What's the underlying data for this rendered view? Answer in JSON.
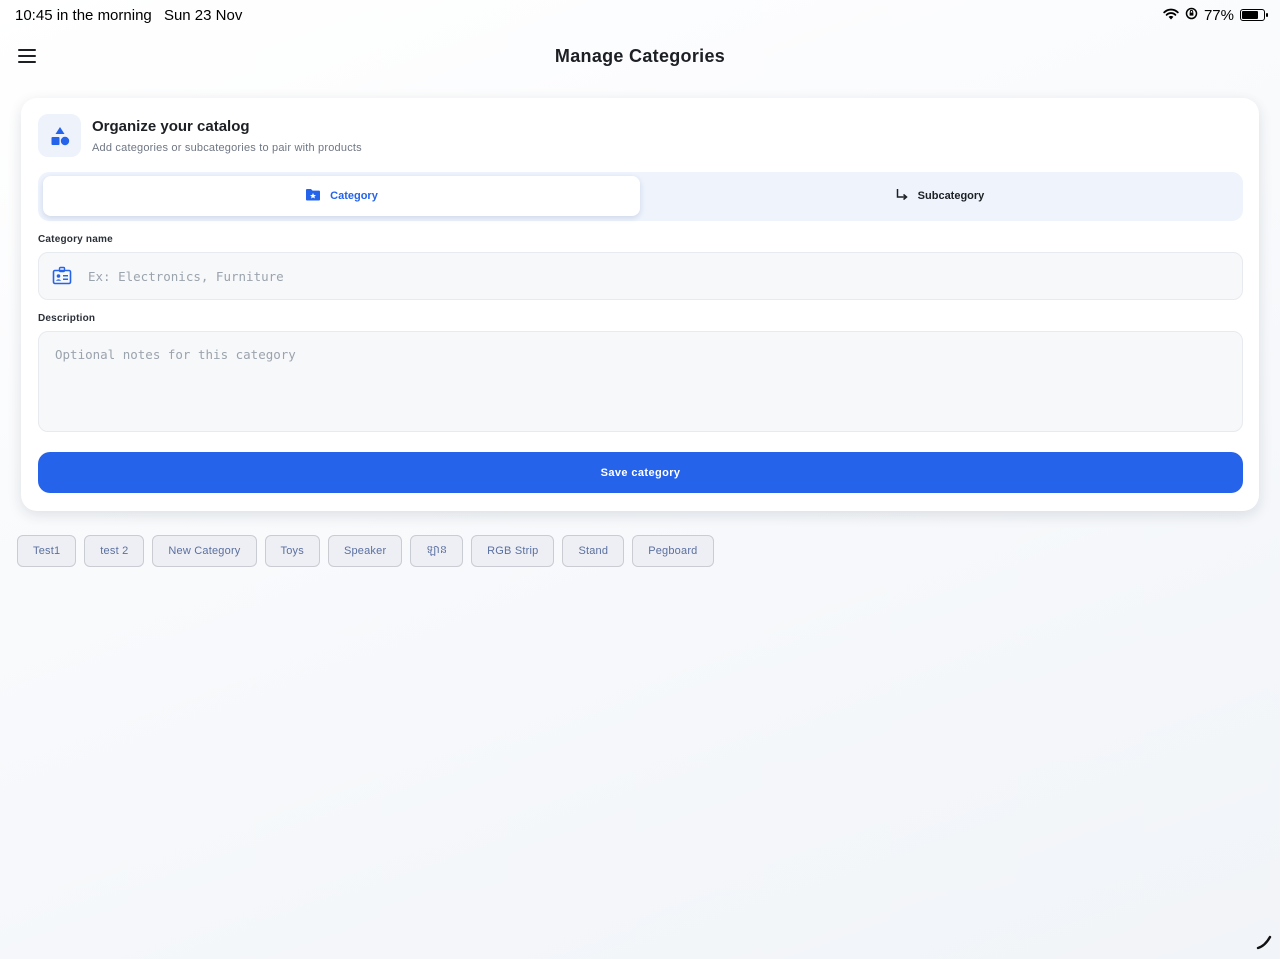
{
  "status_bar": {
    "time": "10:45 in the morning",
    "date": "Sun 23 Nov",
    "battery": "77%"
  },
  "nav": {
    "title": "Manage Categories"
  },
  "card": {
    "title": "Organize your catalog",
    "subtitle": "Add categories or subcategories to pair with products"
  },
  "tabs": [
    {
      "label": "Category",
      "icon": "folder-star-icon",
      "active": true
    },
    {
      "label": "Subcategory",
      "icon": "subdirectory-arrow-icon",
      "active": false
    }
  ],
  "form": {
    "name_label": "Category name",
    "name_placeholder": "Ex: Electronics, Furniture",
    "name_value": "",
    "description_label": "Description",
    "description_placeholder": "Optional notes for this category",
    "description_value": "",
    "save_label": "Save category"
  },
  "categories": [
    "Test1",
    "test 2",
    "New Category",
    "Toys",
    "Speaker",
    "ឡាន",
    "RGB Strip",
    "Stand",
    "Pegboard"
  ],
  "colors": {
    "accent": "#2563eb",
    "tab_background": "#eef3fc"
  }
}
